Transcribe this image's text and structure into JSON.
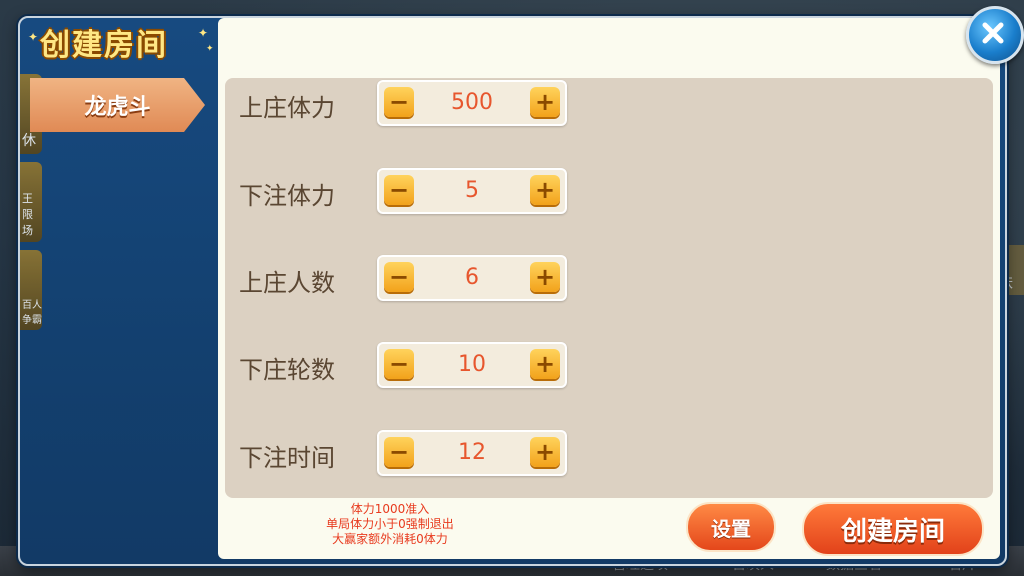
{
  "dialog": {
    "title": "创建房间",
    "tab_game": "龙虎斗",
    "rows": [
      {
        "label": "上庄体力",
        "value": "500"
      },
      {
        "label": "下注体力",
        "value": "5"
      },
      {
        "label": "上庄人数",
        "value": "6"
      },
      {
        "label": "下庄轮数",
        "value": "10"
      },
      {
        "label": "下注时间",
        "value": "12"
      }
    ],
    "minus_symbol": "−",
    "plus_symbol": "+",
    "notes": [
      "体力1000准入",
      "单局体力小于0强制退出",
      "大赢家额外消耗0体力"
    ],
    "settings_label": "设置",
    "create_label": "创建房间"
  },
  "background": {
    "bottom_items": [
      "管理选项",
      "召唤人",
      "数据查看",
      "名片"
    ],
    "side_labels": [
      "休",
      "王限场",
      "百人争霸"
    ],
    "right_label": "肤"
  },
  "icons": {
    "close": "close-icon",
    "star": "star-icon"
  },
  "colors": {
    "dialog_blue": "#13406f",
    "tab_orange": "#e08a55",
    "stepper_button": "#f2a21b",
    "value_text": "#e7562d",
    "note_text": "#e83a1e",
    "create_button": "#e2421a"
  }
}
